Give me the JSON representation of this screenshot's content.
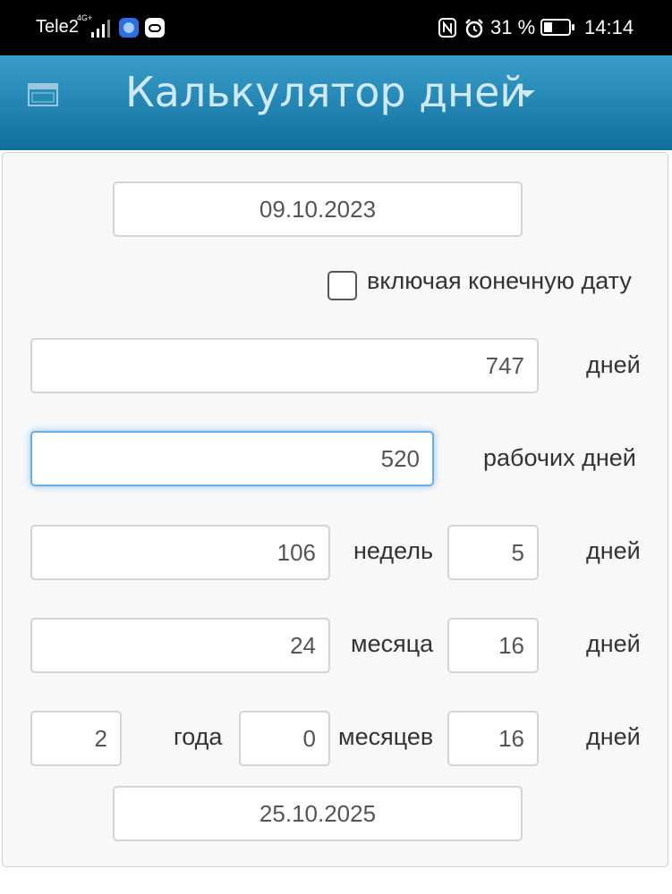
{
  "status_bar": {
    "carrier": "Tele2",
    "network": "4G+",
    "battery_percent": "31 %",
    "time": "14:14"
  },
  "header": {
    "title": "Калькулятор дней",
    "menu_icon": "calendar-menu-icon",
    "dropdown_icon": "caret-down-icon",
    "color_top": "#3a9dca",
    "color_bottom": "#0f6f9d"
  },
  "form": {
    "start_date": "09.10.2023",
    "include_end_date": {
      "label": "включая конечную дату",
      "checked": false
    },
    "days": {
      "value": "747",
      "unit": "дней"
    },
    "working_days": {
      "value": "520",
      "unit": "рабочих дней"
    },
    "weeks": {
      "value": "106",
      "unit": "недель",
      "days_value": "5",
      "days_unit": "дней"
    },
    "months": {
      "value": "24",
      "unit": "месяца",
      "days_value": "16",
      "days_unit": "дней"
    },
    "years": {
      "value": "2",
      "unit": "года",
      "months_value": "0",
      "months_unit": "месяцев",
      "days_value": "16",
      "days_unit": "дней"
    },
    "end_date": "25.10.2025"
  }
}
